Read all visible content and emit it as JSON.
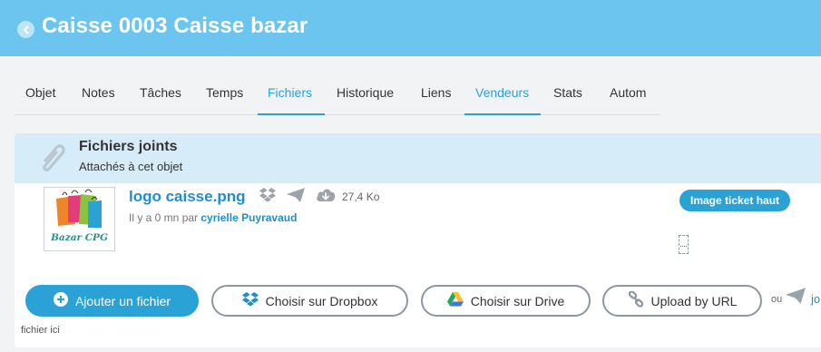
{
  "header": {
    "title": "Caisse 0003 Caisse bazar",
    "back_icon": "chevron-left-circle-icon"
  },
  "tabs": [
    {
      "label": "Objet",
      "active": false
    },
    {
      "label": "Notes",
      "active": false
    },
    {
      "label": "Tâches",
      "active": false
    },
    {
      "label": "Temps",
      "active": false
    },
    {
      "label": "Fichiers",
      "active": true
    },
    {
      "label": "Historique",
      "active": false
    },
    {
      "label": "Liens",
      "active": false
    },
    {
      "label": "Vendeurs",
      "active": true
    },
    {
      "label": "Stats",
      "active": false
    },
    {
      "label": "Autom",
      "active": false
    }
  ],
  "attachments": {
    "title": "Fichiers joints",
    "subtitle": "Attachés à cet objet",
    "icon": "paperclip-icon",
    "file": {
      "name": "logo caisse.png",
      "size": "27,4 Ko",
      "meta_prefix": "Il y a 0 mn par",
      "author": "cyrielle Puyravaud",
      "tag": "Image ticket haut",
      "thumbnail_caption": "Bazar CPG",
      "icons": [
        "dropbox-icon",
        "send-icon",
        "cloud-download-icon"
      ]
    },
    "actions": {
      "add_file": "Ajouter un fichier",
      "dropbox": "Choisir sur Dropbox",
      "drive": "Choisir sur Drive",
      "url": "Upload by URL",
      "or_text": "ou",
      "join_text": "jo"
    },
    "drop_hint": "fichier ici"
  },
  "colors": {
    "header_bg": "#6cc5ef",
    "accent": "#2aa2d6",
    "link": "#1f8fcc",
    "panel_head_bg": "#d6ecf8"
  }
}
